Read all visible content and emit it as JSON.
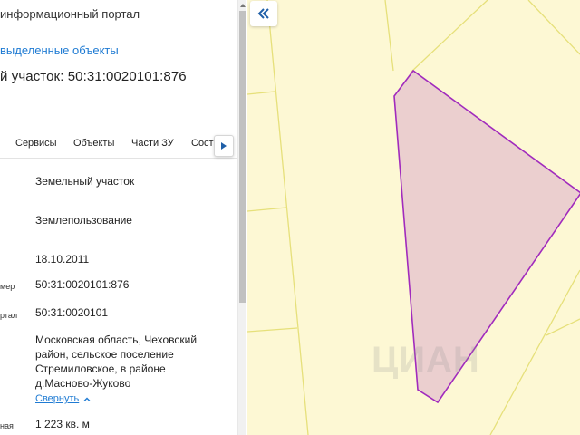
{
  "header": {
    "portal_title": "информационный портал",
    "selected_objects_link": "выделенные объекты",
    "parcel_title": "й участок: 50:31:0020101:876"
  },
  "tabs": [
    {
      "label": "Сервисы"
    },
    {
      "label": "Объекты"
    },
    {
      "label": "Части ЗУ"
    },
    {
      "label": "Соста"
    }
  ],
  "info": {
    "type_value": "Земельный участок",
    "category_value": "Землепользование",
    "date_value": "18.10.2011",
    "number_label": "мер",
    "number_value": "50:31:0020101:876",
    "quarter_label": "ртал",
    "quarter_value": "50:31:0020101",
    "address_lines": [
      "Московская область, Чеховский",
      "район, сельское поселение",
      "Стремиловское, в районе",
      "д.Масново-Жуково"
    ],
    "collapse_link": "Свернуть",
    "area_label": "ная",
    "area_value": "1 223 кв. м"
  },
  "map": {
    "watermark": "ЦИАН",
    "background_color": "#fdf8d4",
    "boundary_color": "#e6e07a",
    "parcel_fill": "#ebcfcf",
    "parcel_stroke": "#a12bbd"
  },
  "icons": {
    "collapse_panel": "double-chevron-left-icon",
    "tab_scroll": "triangle-right-icon",
    "collapse_chevron": "chevron-up-icon"
  }
}
